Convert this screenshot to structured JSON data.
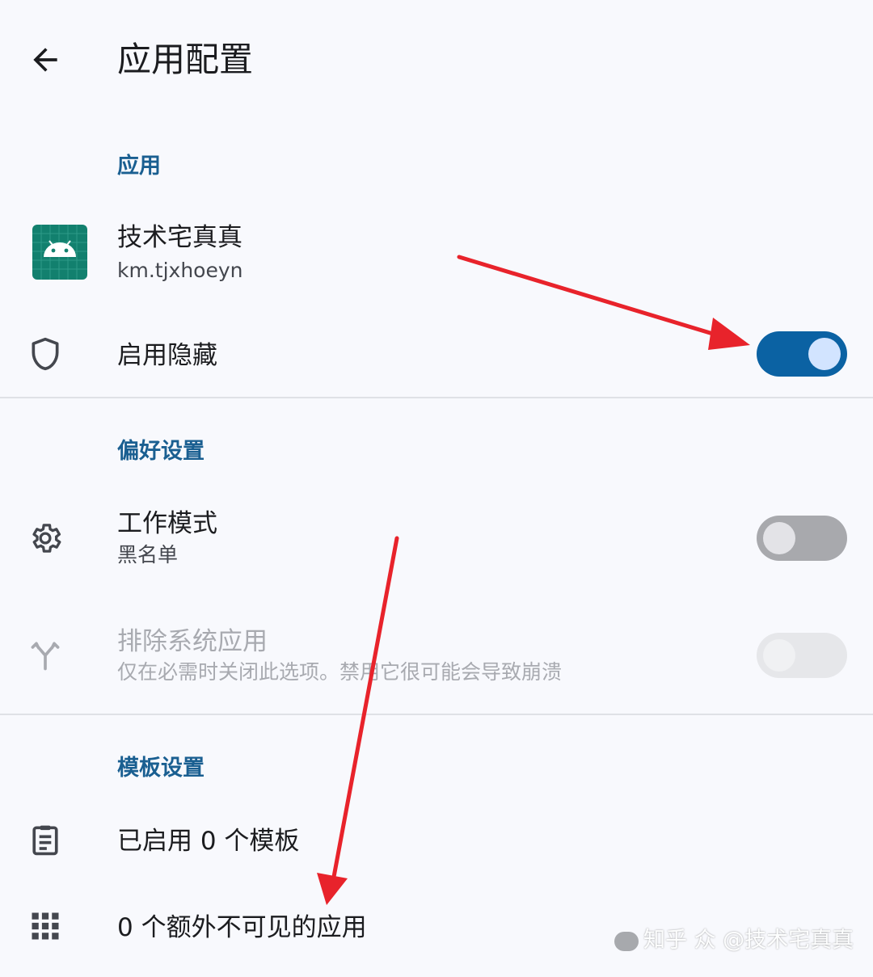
{
  "header": {
    "title": "应用配置",
    "back_icon": "arrow-back-icon"
  },
  "sections": {
    "app": {
      "title": "应用",
      "app_name": "技术宅真真",
      "package": "km.tjxhoeyn",
      "app_icon": "android-robot-icon",
      "enable_hide": {
        "label": "启用隐藏",
        "icon": "shield-icon",
        "on": true
      }
    },
    "prefs": {
      "title": "偏好设置",
      "work_mode": {
        "label": "工作模式",
        "value": "黑名单",
        "icon": "gear-icon",
        "on": false
      },
      "exclude_system": {
        "label": "排除系统应用",
        "desc": "仅在必需时关闭此选项。禁用它很可能会导致崩溃",
        "icon": "fork-icon",
        "on": false,
        "enabled": false
      }
    },
    "templates": {
      "title": "模板设置",
      "enabled_templates": {
        "label": "已启用 0 个模板",
        "icon": "clipboard-icon"
      },
      "extra_apps": {
        "label": "0 个额外不可见的应用",
        "icon": "apps-grid-icon"
      }
    }
  },
  "watermark": "知乎 众 @技术宅真真",
  "colors": {
    "accent": "#0b62a3",
    "section": "#1a5f91",
    "annotation_arrow": "#e8232b",
    "app_icon_bg": "#12806e"
  }
}
